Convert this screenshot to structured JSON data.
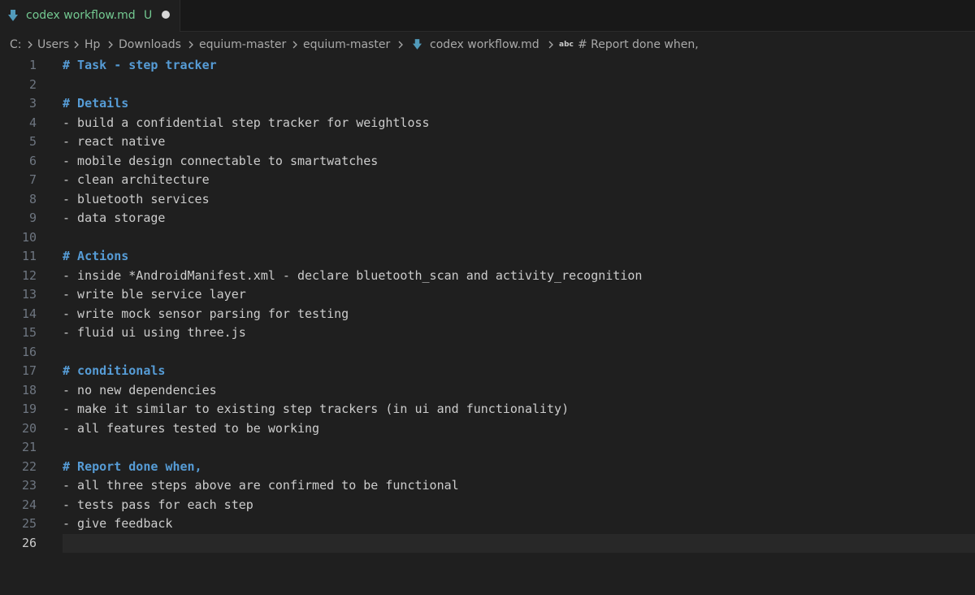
{
  "tab": {
    "title": "codex workflow.md",
    "status": "U",
    "icon": "markdown-icon"
  },
  "breadcrumb": {
    "items": [
      "C:",
      "Users",
      "Hp",
      "Downloads",
      "equium-master",
      "equium-master",
      "codex workflow.md"
    ],
    "symbol": "# Report done when,",
    "symbol_icon_text": "abc"
  },
  "editor": {
    "current_line": 26,
    "lines": [
      {
        "n": "1",
        "text": "# Task - step tracker",
        "kind": "heading"
      },
      {
        "n": "2",
        "text": "",
        "kind": "blank"
      },
      {
        "n": "3",
        "text": "# Details",
        "kind": "heading"
      },
      {
        "n": "4",
        "text": "- build a confidential step tracker for weightloss",
        "kind": "list"
      },
      {
        "n": "5",
        "text": "- react native",
        "kind": "list"
      },
      {
        "n": "6",
        "text": "- mobile design connectable to smartwatches",
        "kind": "list"
      },
      {
        "n": "7",
        "text": "- clean architecture",
        "kind": "list"
      },
      {
        "n": "8",
        "text": "- bluetooth services",
        "kind": "list"
      },
      {
        "n": "9",
        "text": "- data storage",
        "kind": "list"
      },
      {
        "n": "10",
        "text": "",
        "kind": "blank"
      },
      {
        "n": "11",
        "text": "# Actions",
        "kind": "heading"
      },
      {
        "n": "12",
        "text": "- inside *AndroidManifest.xml - declare bluetooth_scan and activity_recognition",
        "kind": "list"
      },
      {
        "n": "13",
        "text": "- write ble service layer",
        "kind": "list"
      },
      {
        "n": "14",
        "text": "- write mock sensor parsing for testing",
        "kind": "list"
      },
      {
        "n": "15",
        "text": "- fluid ui using three.js",
        "kind": "list"
      },
      {
        "n": "16",
        "text": "",
        "kind": "blank"
      },
      {
        "n": "17",
        "text": "# conditionals",
        "kind": "heading"
      },
      {
        "n": "18",
        "text": "- no new dependencies",
        "kind": "list"
      },
      {
        "n": "19",
        "text": "- make it similar to existing step trackers (in ui and functionality)",
        "kind": "list"
      },
      {
        "n": "20",
        "text": "- all features tested to be working",
        "kind": "list"
      },
      {
        "n": "21",
        "text": "",
        "kind": "blank"
      },
      {
        "n": "22",
        "text": "# Report done when,",
        "kind": "heading"
      },
      {
        "n": "23",
        "text": "- all three steps above are confirmed to be functional",
        "kind": "list"
      },
      {
        "n": "24",
        "text": "- tests pass for each step",
        "kind": "list"
      },
      {
        "n": "25",
        "text": "- give feedback",
        "kind": "list"
      },
      {
        "n": "26",
        "text": "",
        "kind": "blank"
      }
    ]
  },
  "colors": {
    "background": "#1f1f1f",
    "heading": "#569cd6",
    "text": "#cccccc",
    "line_number": "#6e7681",
    "untracked": "#73c991"
  }
}
